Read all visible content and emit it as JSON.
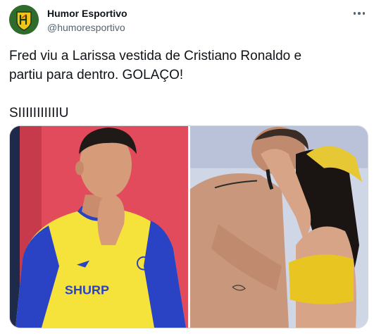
{
  "author": {
    "display_name": "Humor Esportivo",
    "handle": "@humoresportivo",
    "avatar_letters": "HE"
  },
  "tweet": {
    "text": "Fred viu a Larissa vestida de Cristiano Ronaldo e\npartiu para dentro. GOLAÇO!\n\nSIIIIIIIIIIIU"
  },
  "media": {
    "left_photo": {
      "jersey_text": "SHURP",
      "colors": {
        "jersey": "#f5e23a",
        "jersey_trim": "#2a43c4",
        "background": "#e24b5c"
      }
    },
    "right_photo": {
      "colors": {
        "background": "#cfd6e6",
        "top": "#e9c522",
        "bandana": "#e5c834"
      }
    }
  },
  "icons": [
    "more-options-icon"
  ]
}
